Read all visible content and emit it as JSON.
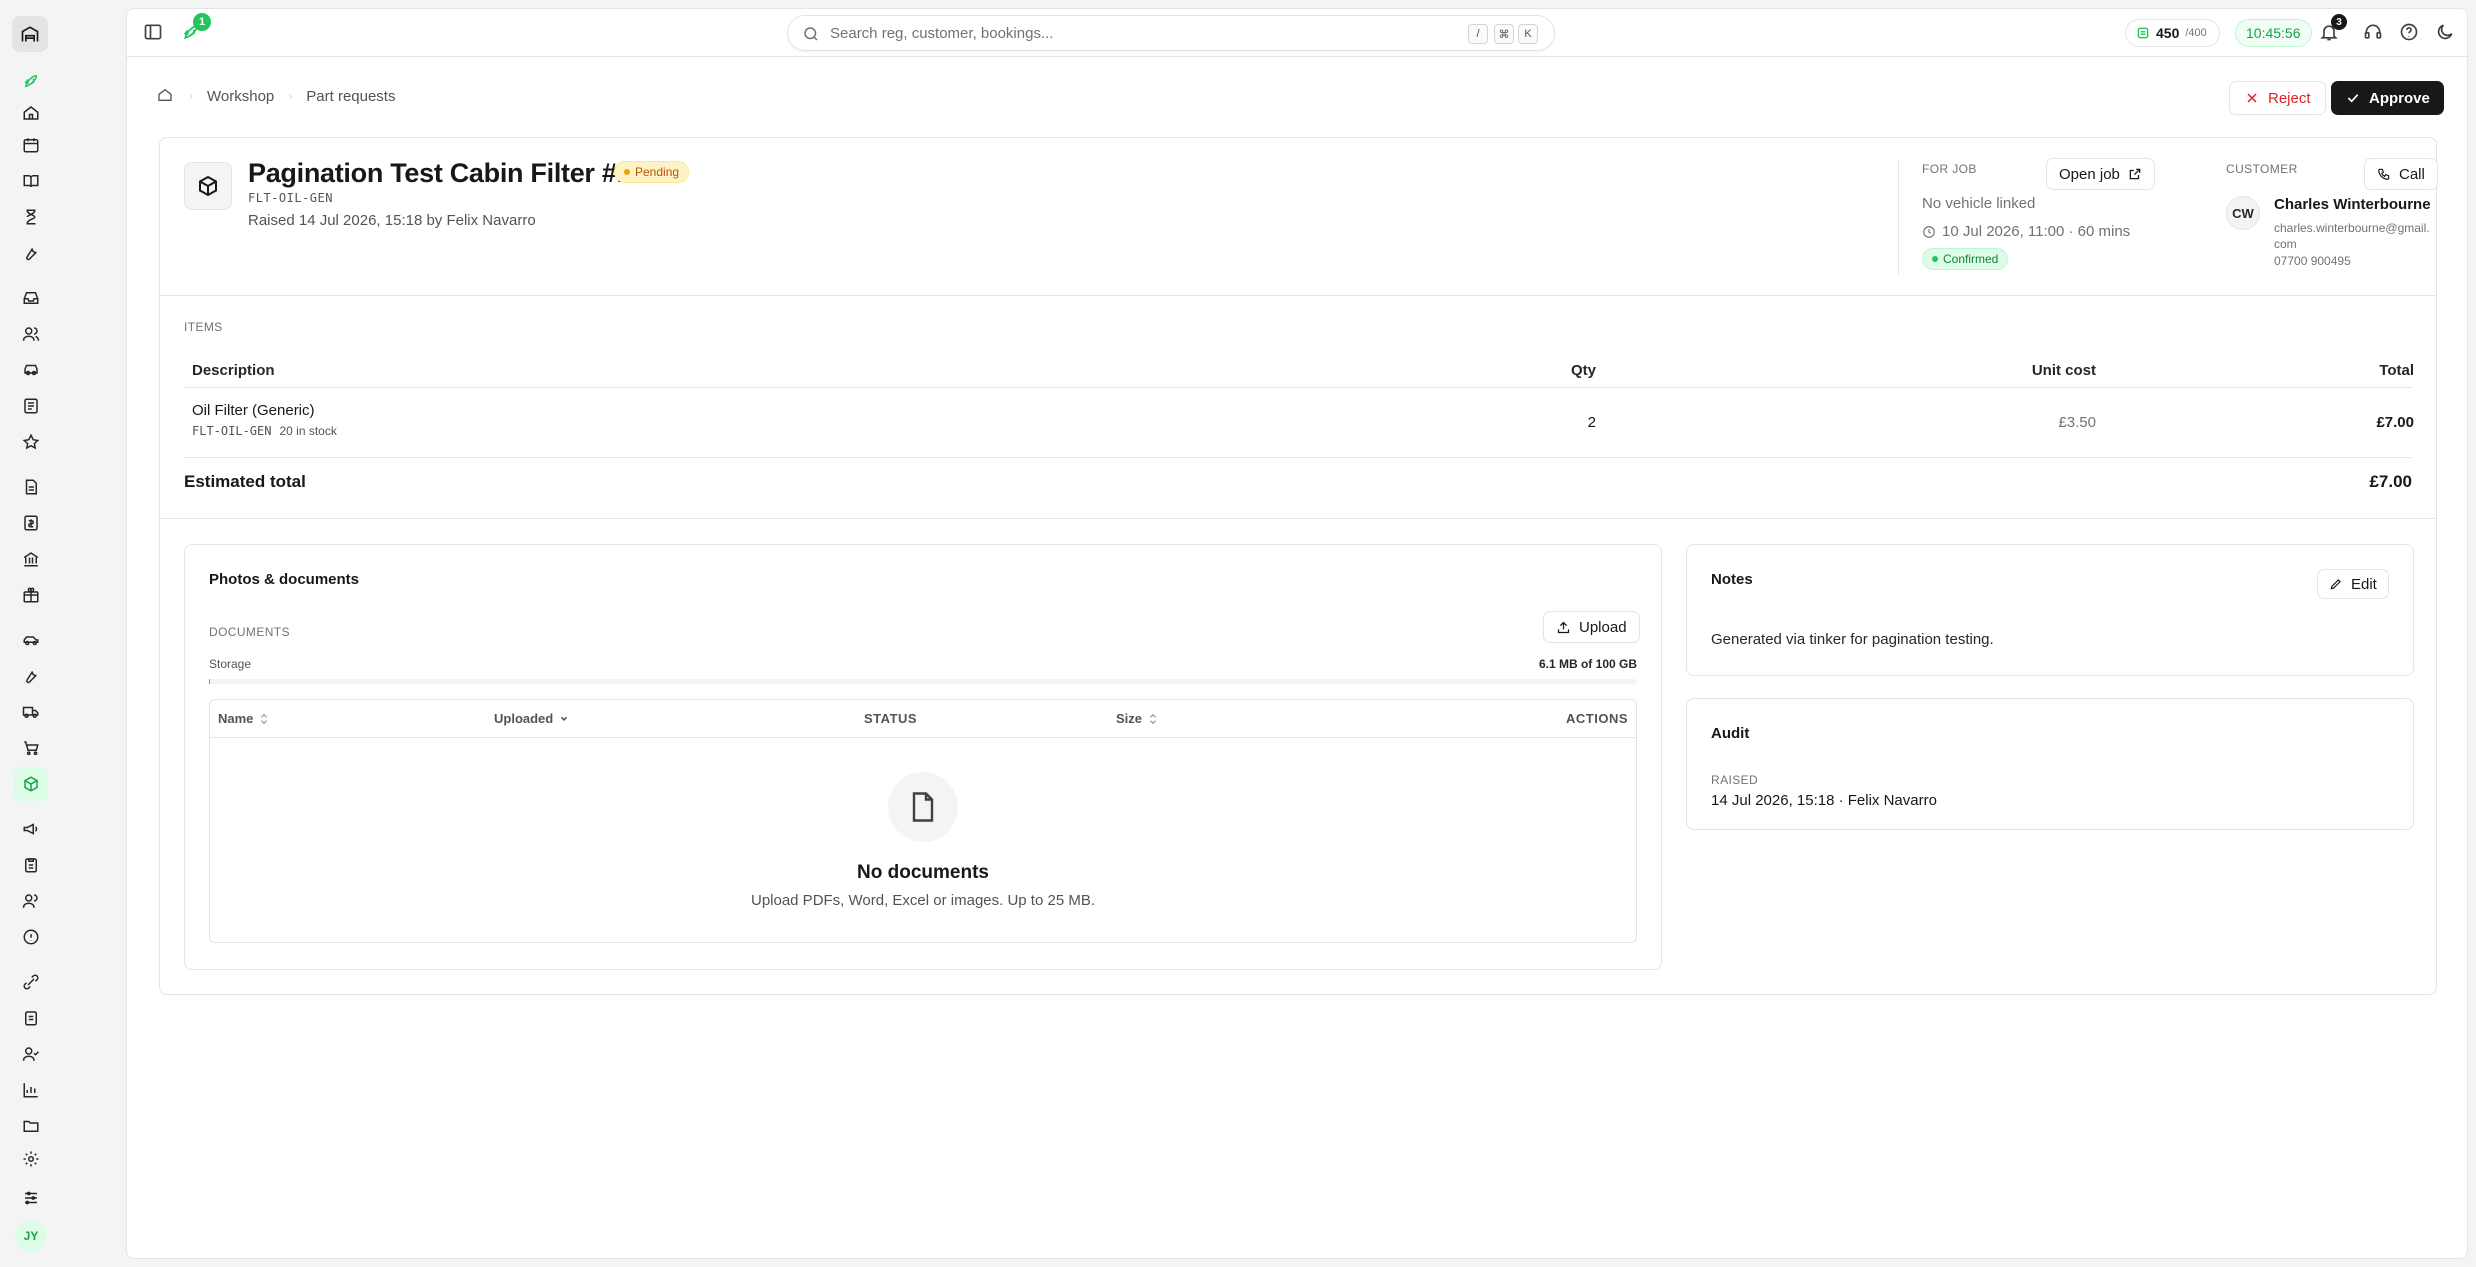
{
  "topbar": {
    "rocket_badge": "1",
    "search_placeholder": "Search reg, customer, bookings...",
    "shortcut_keys": [
      "/",
      "⌘",
      "K"
    ],
    "credits_value": "450",
    "credits_max": "/400",
    "clock": "10:45:56",
    "notifications_count": "3"
  },
  "breadcrumb": {
    "items": [
      "Workshop",
      "Part requests"
    ]
  },
  "actions": {
    "reject_label": "Reject",
    "approve_label": "Approve"
  },
  "request": {
    "title": "Pagination Test Cabin Filter #142",
    "status": "Pending",
    "sku": "FLT-OIL-GEN",
    "raised_line": "Raised 14 Jul 2026, 15:18 by Felix Navarro"
  },
  "job": {
    "label": "For job",
    "open_label": "Open job",
    "vehicle": "No vehicle linked",
    "time": "10 Jul 2026, 11:00 · 60 mins",
    "status": "Confirmed"
  },
  "customer": {
    "label": "Customer",
    "call_label": "Call",
    "initials": "CW",
    "name": "Charles Winterbourne",
    "email": "charles.winterbourne@gmail.com",
    "phone": "07700 900495"
  },
  "items": {
    "label": "Items",
    "columns": {
      "description": "Description",
      "qty": "Qty",
      "unit_cost": "Unit cost",
      "total": "Total"
    },
    "rows": [
      {
        "name": "Oil Filter (Generic)",
        "sku": "FLT-OIL-GEN",
        "stock": "20 in stock",
        "qty": "2",
        "unit_cost": "£3.50",
        "total": "£7.00"
      }
    ],
    "estimated_label": "Estimated total",
    "estimated_value": "£7.00"
  },
  "photos": {
    "title": "Photos & documents",
    "docs_label": "Documents",
    "upload_label": "Upload",
    "storage_label": "Storage",
    "storage_value": "6.1 MB of 100 GB",
    "storage_fraction": 6e-05,
    "columns": {
      "name": "Name",
      "uploaded": "Uploaded",
      "status": "STATUS",
      "size": "Size",
      "actions": "ACTIONS"
    },
    "empty_title": "No documents",
    "empty_sub": "Upload PDFs, Word, Excel or images. Up to 25 MB."
  },
  "notes": {
    "title": "Notes",
    "edit_label": "Edit",
    "body": "Generated via tinker for pagination testing."
  },
  "audit": {
    "title": "Audit",
    "raised_label": "Raised",
    "raised_value": "14 Jul 2026, 15:18 · Felix Navarro"
  },
  "user": {
    "initials": "JY"
  },
  "colors": {
    "accent": "#22c55e",
    "danger": "#dc2626",
    "pending": "#f59e0b",
    "dark": "#18181b"
  }
}
